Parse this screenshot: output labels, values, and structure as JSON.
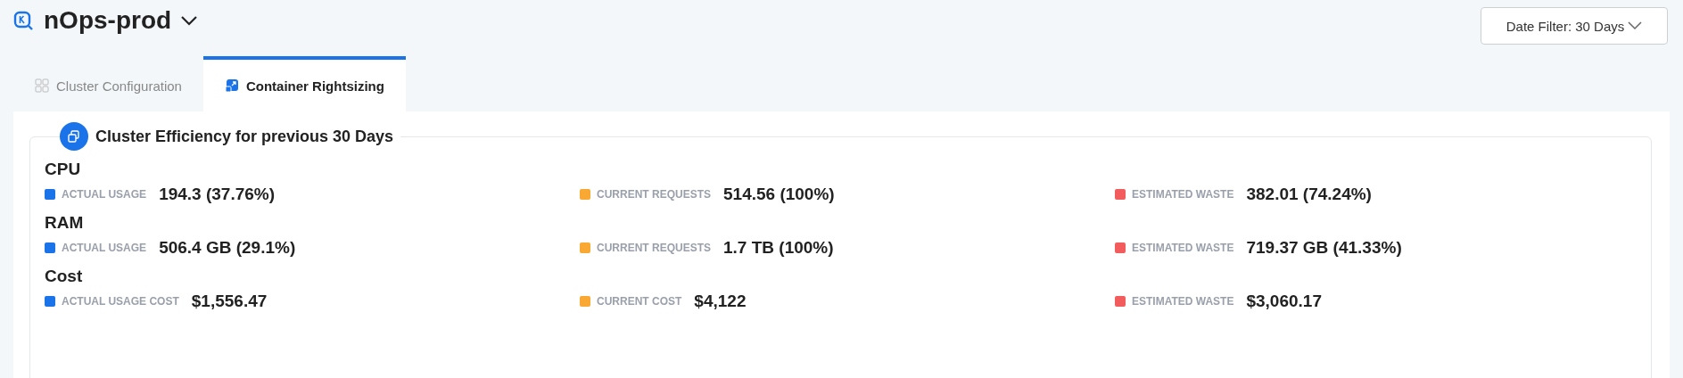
{
  "header": {
    "title": "nOps-prod",
    "date_filter": "Date Filter: 30 Days"
  },
  "tabs": [
    {
      "label": "Cluster Configuration",
      "selected": false
    },
    {
      "label": "Container Rightsizing",
      "selected": true
    }
  ],
  "section": {
    "title": "Cluster Efficiency for previous 30 Days",
    "groups": [
      {
        "name": "CPU",
        "metrics": [
          {
            "label": "ACTUAL USAGE",
            "value": "194.3 (37.76%)",
            "color": "#1a73e8"
          },
          {
            "label": "CURRENT REQUESTS",
            "value": "514.56 (100%)",
            "color": "#f9a933"
          },
          {
            "label": "ESTIMATED WASTE",
            "value": "382.01 (74.24%)",
            "color": "#f25c5c"
          }
        ]
      },
      {
        "name": "RAM",
        "metrics": [
          {
            "label": "ACTUAL USAGE",
            "value": "506.4 GB (29.1%)",
            "color": "#1a73e8"
          },
          {
            "label": "CURRENT REQUESTS",
            "value": "1.7 TB (100%)",
            "color": "#f9a933"
          },
          {
            "label": "ESTIMATED WASTE",
            "value": "719.37 GB (41.33%)",
            "color": "#f25c5c"
          }
        ]
      },
      {
        "name": "Cost",
        "metrics": [
          {
            "label": "ACTUAL USAGE COST",
            "value": "$1,556.47",
            "color": "#1a73e8"
          },
          {
            "label": "CURRENT COST",
            "value": "$4,122",
            "color": "#f9a933"
          },
          {
            "label": "ESTIMATED WASTE",
            "value": "$3,060.17",
            "color": "#f25c5c"
          }
        ]
      }
    ]
  }
}
